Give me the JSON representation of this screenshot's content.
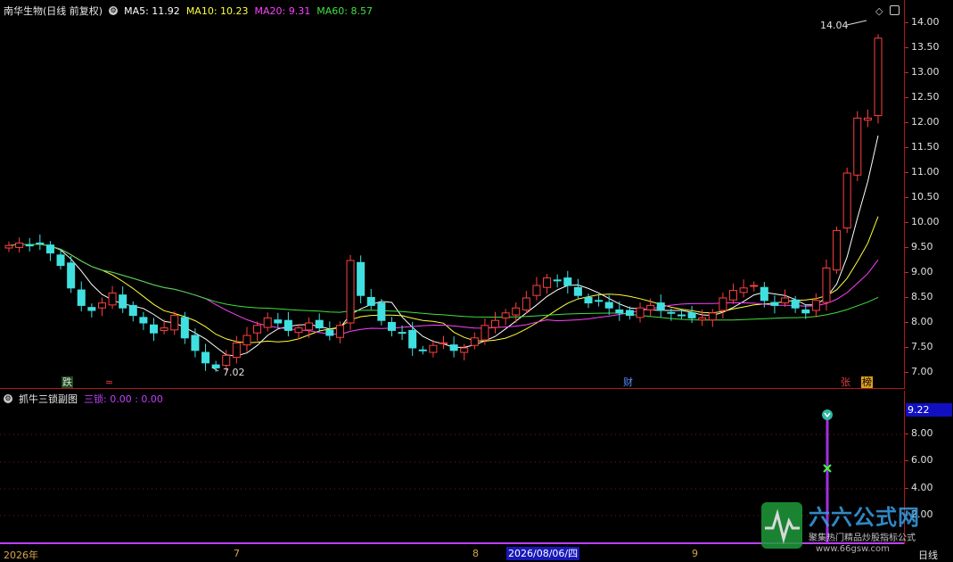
{
  "main_chart": {
    "title": "南华生物(日线 前复权)",
    "indicators": [
      {
        "label": "MA5: 11.92",
        "color": "#ffffff"
      },
      {
        "label": "MA10: 10.23",
        "color": "#ffff3c"
      },
      {
        "label": "MA20: 9.31",
        "color": "#ff40ff"
      },
      {
        "label": "MA60: 8.57",
        "color": "#40e040"
      }
    ],
    "high_label": "14.04",
    "low_label": "7.02"
  },
  "price_axis": [
    "14.00",
    "13.50",
    "13.00",
    "12.50",
    "12.00",
    "11.50",
    "11.00",
    "10.50",
    "10.00",
    "9.50",
    "9.00",
    "8.50",
    "8.00",
    "7.50",
    "7.00"
  ],
  "event_markers": [
    {
      "text": "跌",
      "color": "#2ed42e"
    },
    {
      "text": "≈",
      "color": "#e84040"
    },
    {
      "text": "财",
      "color": "#4080ff"
    },
    {
      "text": "张",
      "color": "#e84040"
    },
    {
      "text": "榜",
      "color": "#e0a020"
    }
  ],
  "sub_chart": {
    "title": "抓牛三锁副图",
    "indicator_label": "三锁: 0.00 : 0.00",
    "indicator_color": "#c040ff",
    "current_value": "9.22"
  },
  "osc_axis": [
    "8.00",
    "6.00",
    "4.00",
    "2.00"
  ],
  "x_axis": {
    "labels": [
      "2026年",
      "7",
      "8",
      "9"
    ],
    "cursor_date": "2026/08/06/四",
    "period": "日线"
  },
  "watermark": {
    "brand": "六六公式网",
    "slogan": "聚集热门精品炒股指标公式",
    "url": "www.66gsw.com"
  },
  "colors": {
    "up": "#ff4040",
    "down": "#40e0e0",
    "ma5": "#ffffff",
    "ma10": "#ffff3c",
    "ma20": "#ff40ff",
    "ma60": "#40e040",
    "frame": "#b01818"
  }
}
